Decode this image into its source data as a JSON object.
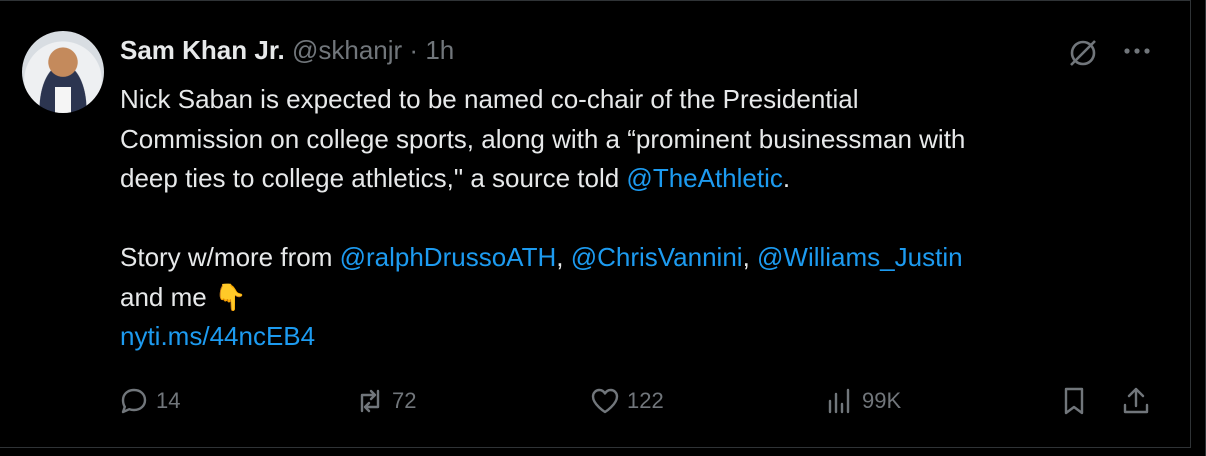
{
  "author": {
    "name": "Sam Khan Jr.",
    "handle": "@skhanjr",
    "separator": "·",
    "time": "1h"
  },
  "tweet": {
    "line1": "Nick Saban is expected to be named co-chair of the Presidential",
    "line2": "Commission on college sports, along with a “prominent businessman with",
    "line3a": "deep ties to college athletics,\" a source told ",
    "mention1": "@TheAthletic",
    "line3b": ".",
    "line5a": "Story w/more from ",
    "mention2": "@ralphDrussoATH",
    "sep1": ", ",
    "mention3": "@ChrisVannini",
    "sep2": ", ",
    "mention4": "@Williams_Justin",
    "line6": "and me ",
    "emoji": "👇",
    "link": "nyti.ms/44ncEB4"
  },
  "actions": {
    "replies": "14",
    "reposts": "72",
    "likes": "122",
    "views": "99K"
  },
  "icons": {
    "more": "more-horizontal-icon",
    "grok": "grok-icon"
  },
  "colors": {
    "accent": "#1d9bf0",
    "muted": "#71767b",
    "text": "#e7e9ea",
    "background": "#000000"
  }
}
